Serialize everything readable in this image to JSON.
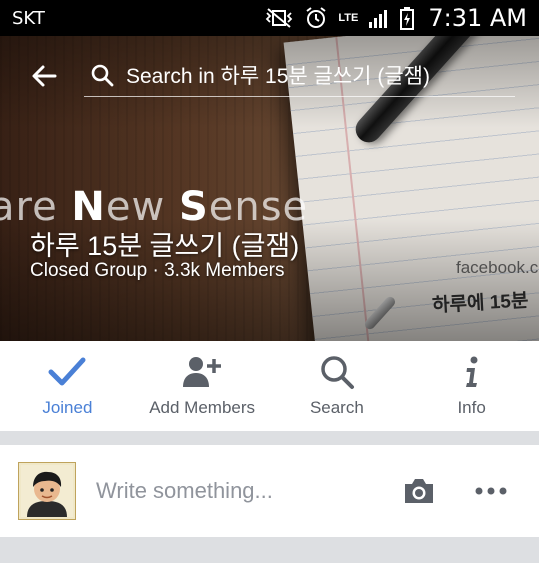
{
  "status_bar": {
    "carrier": "SKT",
    "network": "LTE",
    "time": "7:31 AM"
  },
  "search": {
    "placeholder": "Search in 하루 15분 글쓰기 (글잼)"
  },
  "cover": {
    "tagline_prefix": "are ",
    "tagline_n": "N",
    "tagline_ew": "ew ",
    "tagline_s": "S",
    "tagline_ense": "ense",
    "watermark": "facebook.c",
    "handwriting": "하루에 15분"
  },
  "group": {
    "name": "하루 15분 글쓰기 (글잼)",
    "meta": "Closed Group · 3.3k Members"
  },
  "actions": [
    {
      "label": "Joined",
      "icon": "check-icon"
    },
    {
      "label": "Add Members",
      "icon": "add-person-icon"
    },
    {
      "label": "Search",
      "icon": "search-icon"
    },
    {
      "label": "Info",
      "icon": "info-icon"
    }
  ],
  "composer": {
    "placeholder": "Write something..."
  },
  "colors": {
    "accent": "#4a80d6",
    "icon_gray": "#5b6068",
    "divider": "#dddfe2"
  }
}
